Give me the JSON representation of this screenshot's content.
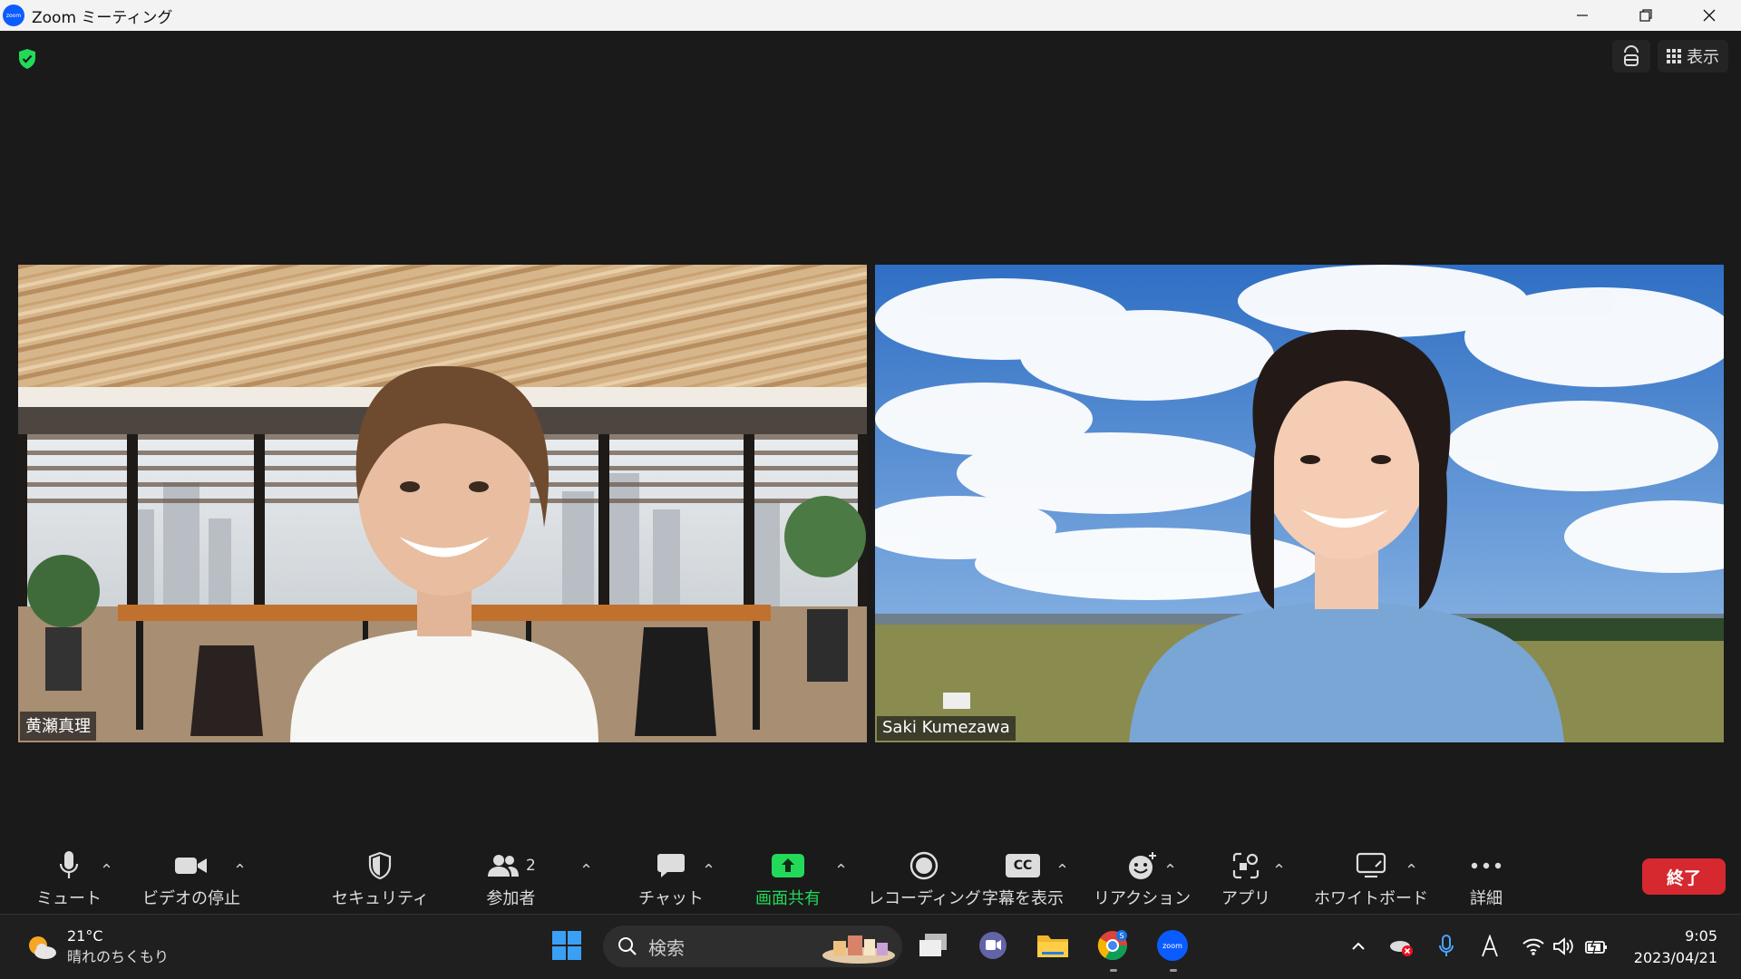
{
  "window": {
    "title": "Zoom ミーティング",
    "logo_text": "zoom"
  },
  "header": {
    "view_label": "表示"
  },
  "participants": [
    {
      "name": "黄瀬真理"
    },
    {
      "name": "Saki Kumezawa"
    }
  ],
  "toolbar": {
    "mute": "ミュート",
    "video": "ビデオの停止",
    "security": "セキュリティ",
    "participants": "参加者",
    "participants_count": "2",
    "chat": "チャット",
    "share": "画面共有",
    "record": "レコーディング",
    "captions": "字幕を表示",
    "captions_icon": "CC",
    "reactions": "リアクション",
    "apps": "アプリ",
    "whiteboard": "ホワイトボード",
    "more": "詳細",
    "end": "終了"
  },
  "taskbar": {
    "weather_temp": "21°C",
    "weather_desc": "晴れのちくもり",
    "search_placeholder": "検索",
    "zoom_icon_text": "zoom",
    "chrome_badge": "S",
    "time": "9:05",
    "date": "2023/04/21"
  },
  "colors": {
    "accent_green": "#23d959",
    "end_red": "#d6282f",
    "zoom_blue": "#0b5cff"
  }
}
